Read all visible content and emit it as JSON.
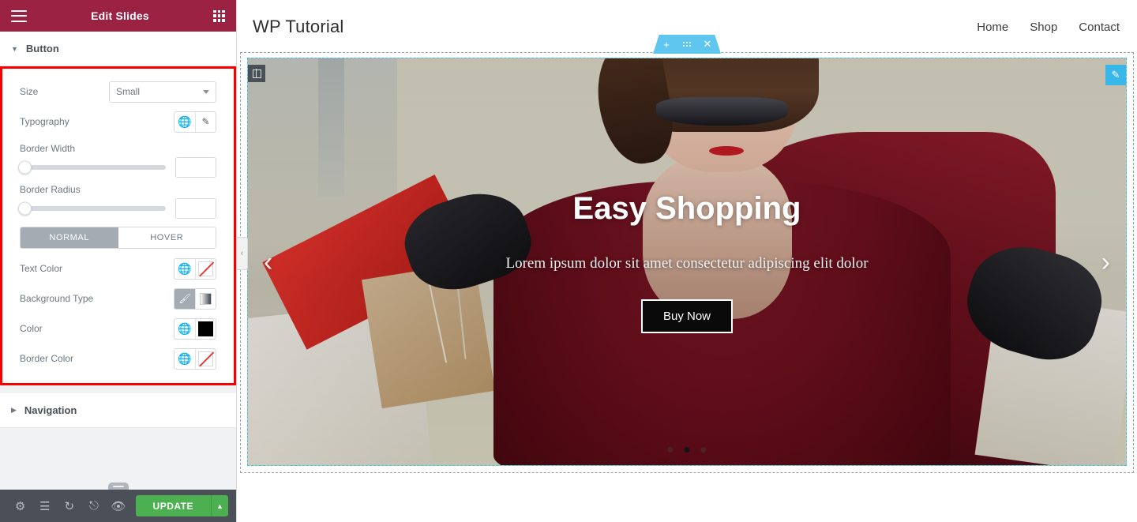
{
  "panel": {
    "header": {
      "title": "Edit Slides",
      "menu_icon": "hamburger-icon",
      "apps_icon": "grid-apps-icon"
    },
    "section": {
      "title": "Button",
      "collapsed_title": "Navigation"
    },
    "controls": {
      "size": {
        "label": "Size",
        "value": "Small"
      },
      "typography": {
        "label": "Typography",
        "globe_icon": "globe-icon",
        "edit_icon": "pencil-icon"
      },
      "border_width": {
        "label": "Border Width",
        "value": ""
      },
      "border_radius": {
        "label": "Border Radius",
        "value": ""
      },
      "tabs": {
        "normal": "NORMAL",
        "hover": "HOVER",
        "active": "NORMAL"
      },
      "text_color": {
        "label": "Text Color",
        "globe_icon": "globe-icon",
        "swatch": "none"
      },
      "background_type": {
        "label": "Background Type",
        "classic_icon": "paintbrush-icon",
        "gradient_icon": "gradient-icon",
        "active": "classic"
      },
      "color": {
        "label": "Color",
        "globe_icon": "globe-icon",
        "swatch": "#000000"
      },
      "border_color": {
        "label": "Border Color",
        "globe_icon": "globe-icon",
        "swatch": "none"
      }
    },
    "footer": {
      "icons": [
        "gear-icon",
        "layers-icon",
        "history-icon",
        "responsive-icon",
        "preview-eye-icon"
      ],
      "update_label": "UPDATE",
      "update_caret": "caret-up-icon",
      "update_color": "#4caf50"
    },
    "highlight_color": "#f60000",
    "header_color": "#9b2242"
  },
  "preview": {
    "site_title": "WP Tutorial",
    "nav": [
      {
        "label": "Home"
      },
      {
        "label": "Shop"
      },
      {
        "label": "Contact"
      }
    ],
    "section_toolbar": {
      "add_icon": "plus-icon",
      "drag_icon": "drag-handle-icon",
      "close_icon": "close-x-icon",
      "color": "#5ec6ef"
    },
    "column_handle_icon": "column-layout-icon",
    "edit_badge_icon": "pencil-edit-icon",
    "slide": {
      "heading": "Easy Shopping",
      "subtitle": "Lorem ipsum dolor sit amet consectetur adipiscing elit dolor",
      "button_label": "Buy Now",
      "prev_icon": "chevron-left-icon",
      "next_icon": "chevron-right-icon",
      "dots": 3,
      "active_dot": 2
    },
    "panel_collapse_icon": "chevron-left-icon"
  }
}
